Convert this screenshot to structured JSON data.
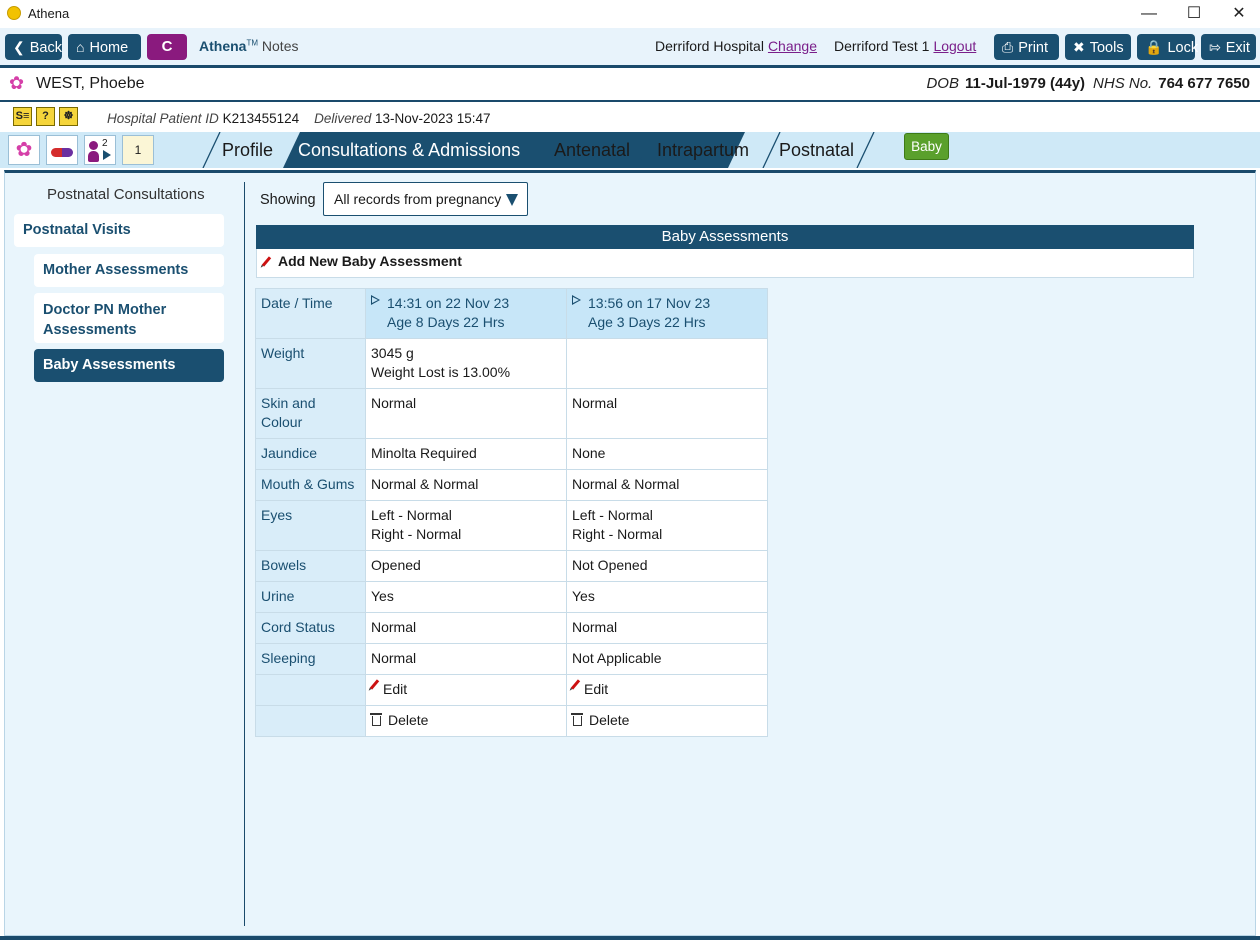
{
  "window": {
    "title": "Athena",
    "minimize": "—",
    "maximize": "☐",
    "close": "✕"
  },
  "toolbar": {
    "back": "Back",
    "home": "Home",
    "c_label": "C",
    "app_name": "Athena",
    "app_tm": "TM",
    "app_suffix": "Notes",
    "hospital": "Derriford Hospital",
    "change": "Change",
    "user": "Derriford Test 1",
    "logout": "Logout",
    "print": "Print",
    "tools": "Tools",
    "lock": "Lock",
    "exit": "Exit"
  },
  "patient": {
    "name": "WEST, Phoebe",
    "dob_label": "DOB",
    "dob_value": "11-Jul-1979 (44y)",
    "nhs_label": "NHS No.",
    "nhs_value": "764 677 7650",
    "hospital_id_label": "Hospital Patient ID",
    "hospital_id": "K213455124",
    "delivered_label": "Delivered",
    "delivered_value": "13-Nov-2023 15:47"
  },
  "status_icons": [
    "S≡",
    "?",
    "☸"
  ],
  "quick_icons": {
    "badge_count": "2",
    "notes_count": "1"
  },
  "tabs": [
    "Profile",
    "Consultations & Admissions",
    "Antenatal",
    "Intrapartum",
    "Postnatal"
  ],
  "baby_button": "Baby",
  "nav": {
    "title": "Postnatal Consultations",
    "items": [
      "Postnatal Visits",
      "Mother Assessments",
      "Doctor PN Mother Assessments",
      "Baby Assessments"
    ]
  },
  "filter": {
    "label": "Showing",
    "value": "All records from pregnancy"
  },
  "section": {
    "title": "Baby Assessments",
    "add_label": "Add New Baby Assessment"
  },
  "table": {
    "header_label": "Date / Time",
    "columns": [
      {
        "datetime": "14:31 on 22 Nov 23",
        "age": "Age 8 Days 22 Hrs"
      },
      {
        "datetime": "13:56 on 17 Nov 23",
        "age": "Age 3 Days 22 Hrs"
      }
    ],
    "rows": [
      {
        "label": "Weight",
        "values": [
          [
            "3045 g",
            "Weight Lost is 13.00%"
          ],
          [
            ""
          ]
        ]
      },
      {
        "label": "Skin and Colour",
        "values": [
          [
            "Normal"
          ],
          [
            "Normal"
          ]
        ]
      },
      {
        "label": "Jaundice",
        "values": [
          [
            "Minolta Required"
          ],
          [
            "None"
          ]
        ]
      },
      {
        "label": "Mouth & Gums",
        "values": [
          [
            "Normal & Normal"
          ],
          [
            "Normal & Normal"
          ]
        ]
      },
      {
        "label": "Eyes",
        "values": [
          [
            "Left - Normal",
            "Right - Normal"
          ],
          [
            "Left - Normal",
            "Right - Normal"
          ]
        ]
      },
      {
        "label": "Bowels",
        "values": [
          [
            "Opened"
          ],
          [
            "Not Opened"
          ]
        ]
      },
      {
        "label": "Urine",
        "values": [
          [
            "Yes"
          ],
          [
            "Yes"
          ]
        ]
      },
      {
        "label": "Cord Status",
        "values": [
          [
            "Normal"
          ],
          [
            "Normal"
          ]
        ]
      },
      {
        "label": "Sleeping",
        "values": [
          [
            "Normal"
          ],
          [
            "Not Applicable"
          ]
        ]
      }
    ],
    "edit_label": "Edit",
    "delete_label": "Delete"
  },
  "colors": {
    "primary": "#1a4f70",
    "c_button": "#8a1a7e",
    "baby_button": "#5aa02c",
    "link": "#7a1f8a",
    "panel": "#e9f5fc"
  }
}
